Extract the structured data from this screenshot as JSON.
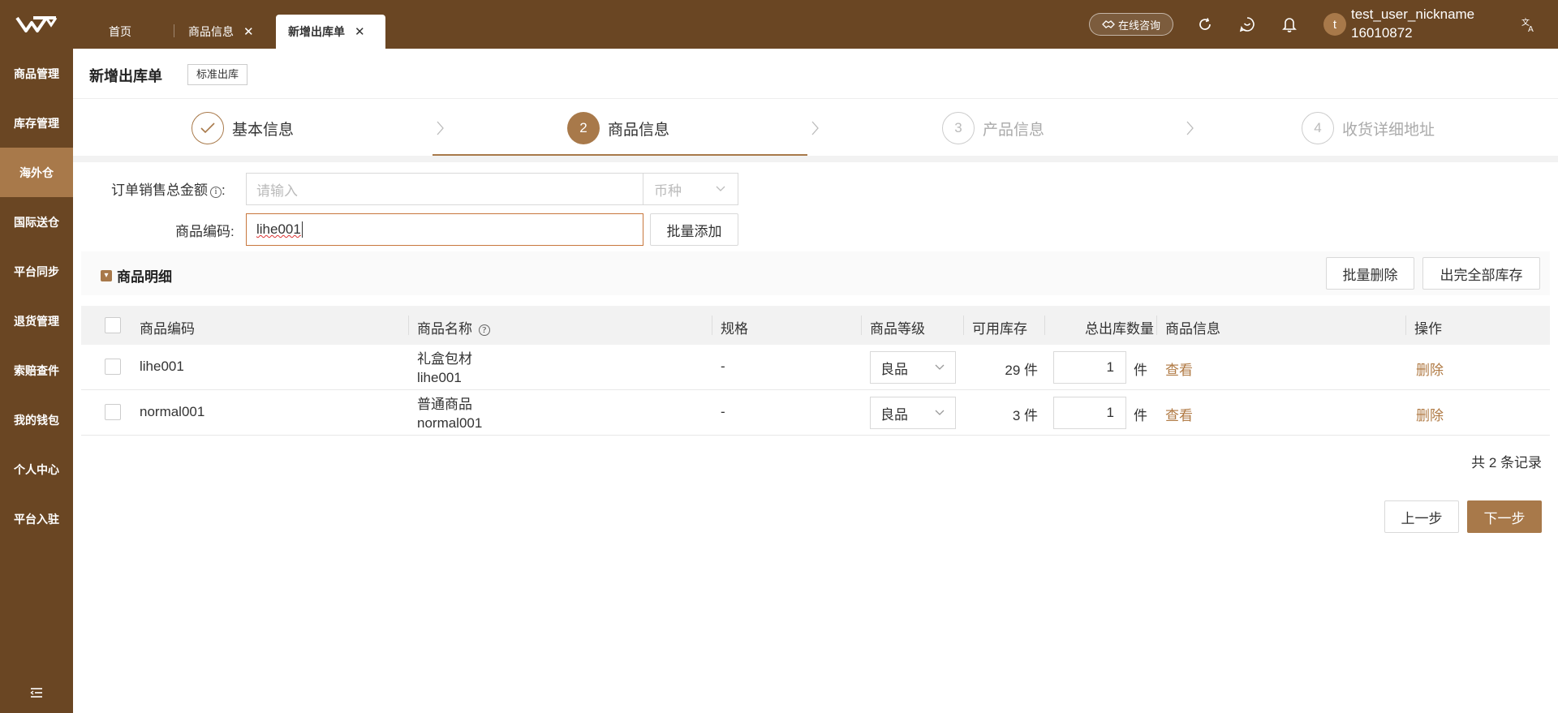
{
  "colors": {
    "sidebar_bg": "#6a4623",
    "accent": "#a8794a",
    "link": "#b07a44"
  },
  "sidebar": {
    "logo_icon": "w-logo-icon",
    "items": [
      {
        "label": "商品管理"
      },
      {
        "label": "库存管理"
      },
      {
        "label": "海外仓",
        "active": true
      },
      {
        "label": "国际送仓"
      },
      {
        "label": "平台同步"
      },
      {
        "label": "退货管理"
      },
      {
        "label": "索赔查件"
      },
      {
        "label": "我的钱包"
      },
      {
        "label": "个人中心"
      },
      {
        "label": "平台入驻"
      }
    ],
    "collapse_icon": "menu-collapse-icon"
  },
  "topbar": {
    "tabs": [
      {
        "label": "首页"
      },
      {
        "label": "商品信息"
      },
      {
        "label": "新增出库单",
        "active": true
      }
    ],
    "consult_label": "在线咨询",
    "icons": [
      "refresh-icon",
      "feedback-icon",
      "bell-icon",
      "translate-icon"
    ],
    "user": {
      "avatar_letter": "t",
      "name": "test_user_nickname",
      "id": "16010872"
    }
  },
  "page": {
    "title": "新增出库单",
    "tag": "标准出库"
  },
  "steps": [
    {
      "number": "1",
      "label": "基本信息",
      "status": "done"
    },
    {
      "number": "2",
      "label": "商品信息",
      "status": "active"
    },
    {
      "number": "3",
      "label": "产品信息",
      "status": "todo"
    },
    {
      "number": "4",
      "label": "收货详细地址",
      "status": "todo"
    }
  ],
  "form": {
    "order_amount_label": "订单销售总金额",
    "order_amount_colon": ":",
    "order_amount_placeholder": "请输入",
    "currency_placeholder": "币种",
    "product_code_label": "商品编码:",
    "product_code_value": "lihe001",
    "batch_add_label": "批量添加"
  },
  "section": {
    "title": "商品明细",
    "batch_delete_label": "批量删除",
    "ship_all_label": "出完全部库存"
  },
  "table": {
    "headers": [
      "商品编码",
      "商品名称",
      "规格",
      "商品等级",
      "可用库存",
      "总出库数量",
      "商品信息",
      "操作"
    ],
    "rows": [
      {
        "code": "lihe001",
        "name": "礼盒包材",
        "name_code": "lihe001",
        "spec": "-",
        "grade": "良品",
        "stock": "29 件",
        "qty": "1",
        "unit": "件",
        "info_link": "查看",
        "action": "删除"
      },
      {
        "code": "normal001",
        "name": "普通商品",
        "name_code": "normal001",
        "spec": "-",
        "grade": "良品",
        "stock": "3 件",
        "qty": "1",
        "unit": "件",
        "info_link": "查看",
        "action": "删除"
      }
    ],
    "total_text": "共 2 条记录"
  },
  "footer": {
    "prev_label": "上一步",
    "next_label": "下一步"
  }
}
